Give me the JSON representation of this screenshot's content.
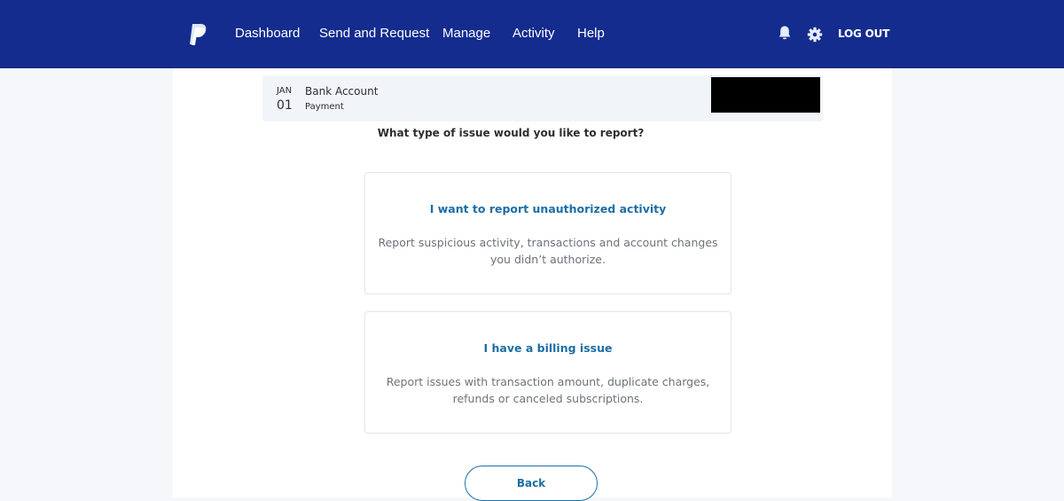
{
  "header": {
    "logo": "paypal-logo",
    "nav": [
      "Dashboard",
      "Send and Request",
      "Manage",
      "Activity",
      "Help"
    ],
    "icons": [
      "bell-icon",
      "gear-icon"
    ],
    "logout_label": "LOG OUT",
    "colors": {
      "bar": "#142c8e"
    }
  },
  "transaction": {
    "month": "JAN",
    "day": "01",
    "name": "Bank Account",
    "type": "Payment",
    "amount_redacted": true
  },
  "prompt": "What type of issue would you like to report?",
  "options": [
    {
      "title": "I want to report unauthorized activity",
      "description": "Report suspicious activity, transactions and account changes you didn’t authorize."
    },
    {
      "title": "I have a billing issue",
      "description": "Report issues with transaction amount, duplicate charges, refunds or canceled subscriptions."
    }
  ],
  "back_label": "Back",
  "colors": {
    "accent": "#1c6ea4",
    "muted_text": "#6c7378"
  }
}
